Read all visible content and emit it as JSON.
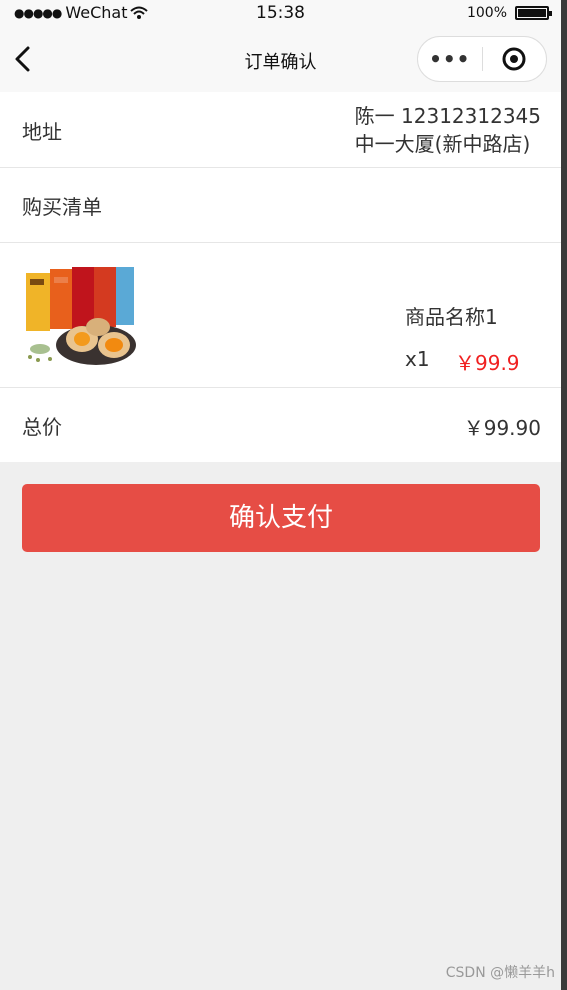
{
  "status_bar": {
    "signal": "●●●●●",
    "carrier": "WeChat",
    "time": "15:38",
    "battery": "100%"
  },
  "nav": {
    "title": "订单确认",
    "more_glyph": "•••"
  },
  "address": {
    "label": "地址",
    "line1": "陈一 12312312345",
    "line2": "中一大厦(新中路店)"
  },
  "purchase_list": {
    "label": "购买清单"
  },
  "item": {
    "name": "商品名称1",
    "quantity": "x1",
    "price": "￥99.9"
  },
  "total": {
    "label": "总价",
    "value": "￥99.90"
  },
  "pay_button": {
    "label": "确认支付",
    "color": "#e64d45"
  },
  "watermark": "CSDN @懒羊羊h"
}
